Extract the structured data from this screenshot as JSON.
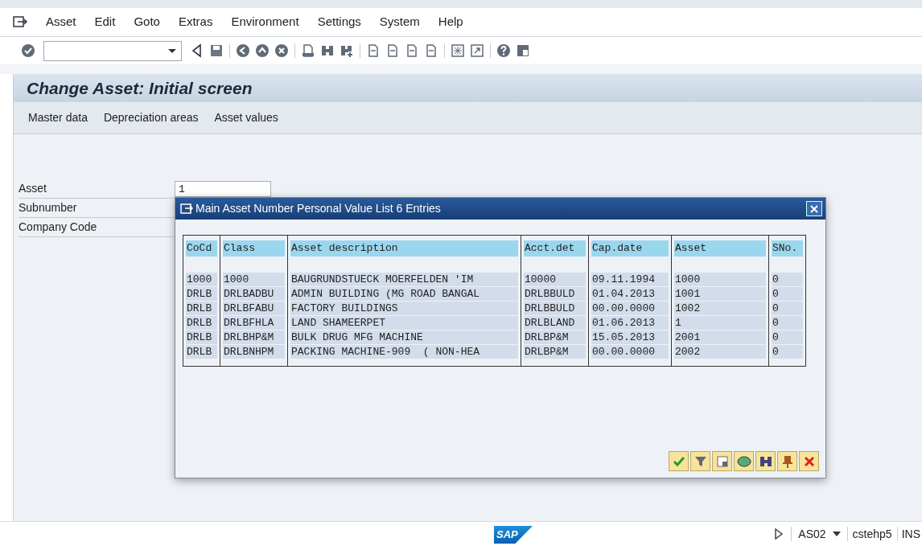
{
  "menu": [
    "Asset",
    "Edit",
    "Goto",
    "Extras",
    "Environment",
    "Settings",
    "System",
    "Help"
  ],
  "title": "Change Asset: Initial screen",
  "app_toolbar": [
    "Master data",
    "Depreciation areas",
    "Asset values"
  ],
  "fields": [
    {
      "label": "Asset",
      "value": "1"
    },
    {
      "label": "Subnumber"
    },
    {
      "label": "Company Code"
    }
  ],
  "dialog": {
    "title": "Main Asset Number Personal Value List 6 Entries",
    "columns": [
      "CoCd",
      "Class",
      "Asset description",
      "Acct.det",
      "Cap.date",
      "Asset",
      "SNo."
    ],
    "rows": [
      [
        "1000",
        "1000",
        "BAUGRUNDSTUECK MOERFELDEN 'IM",
        "10000",
        "09.11.1994",
        "1000",
        "0"
      ],
      [
        "DRLB",
        "DRLBADBU",
        "ADMIN BUILDING (MG ROAD BANGAL",
        "DRLBBULD",
        "01.04.2013",
        "1001",
        "0"
      ],
      [
        "DRLB",
        "DRLBFABU",
        "FACTORY BUILDINGS",
        "DRLBBULD",
        "00.00.0000",
        "1002",
        "0"
      ],
      [
        "DRLB",
        "DRLBFHLA",
        "LAND SHAMEERPET",
        "DRLBLAND",
        "01.06.2013",
        "1",
        "0"
      ],
      [
        "DRLB",
        "DRLBHP&M",
        "BULK DRUG MFG MACHINE",
        "DRLBP&M",
        "15.05.2013",
        "2001",
        "0"
      ],
      [
        "DRLB",
        "DRLBNHPM",
        "PACKING MACHINE-909  ( NON-HEA",
        "DRLBP&M",
        "00.00.0000",
        "2002",
        "0"
      ]
    ]
  },
  "status_bar": {
    "logo": "SAP",
    "transaction": "AS02",
    "server": "cstehp5",
    "mode": "INS"
  }
}
